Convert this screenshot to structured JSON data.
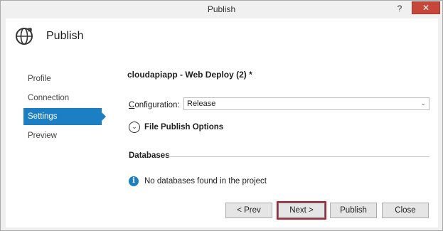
{
  "window": {
    "title": "Publish",
    "help_label": "?",
    "close_label": "✕"
  },
  "header": {
    "icon": "globe-upload-icon",
    "title": "Publish"
  },
  "nav": {
    "items": [
      {
        "label": "Profile"
      },
      {
        "label": "Connection"
      },
      {
        "label": "Settings",
        "active": true
      },
      {
        "label": "Preview"
      }
    ]
  },
  "main": {
    "profile_title": "cloudapiapp - Web Deploy (2) *",
    "configuration_label_prefix": "C",
    "configuration_label_rest": "onfiguration:",
    "configuration_value": "Release",
    "file_publish_options": "File Publish Options",
    "databases_heading": "Databases",
    "databases_info": "No databases found in the project"
  },
  "buttons": {
    "prev": "< Prev",
    "next": "Next >",
    "publish": "Publish",
    "close": "Close"
  },
  "colors": {
    "accent": "#1c7fc4",
    "highlight_outline": "#d11a1a"
  }
}
